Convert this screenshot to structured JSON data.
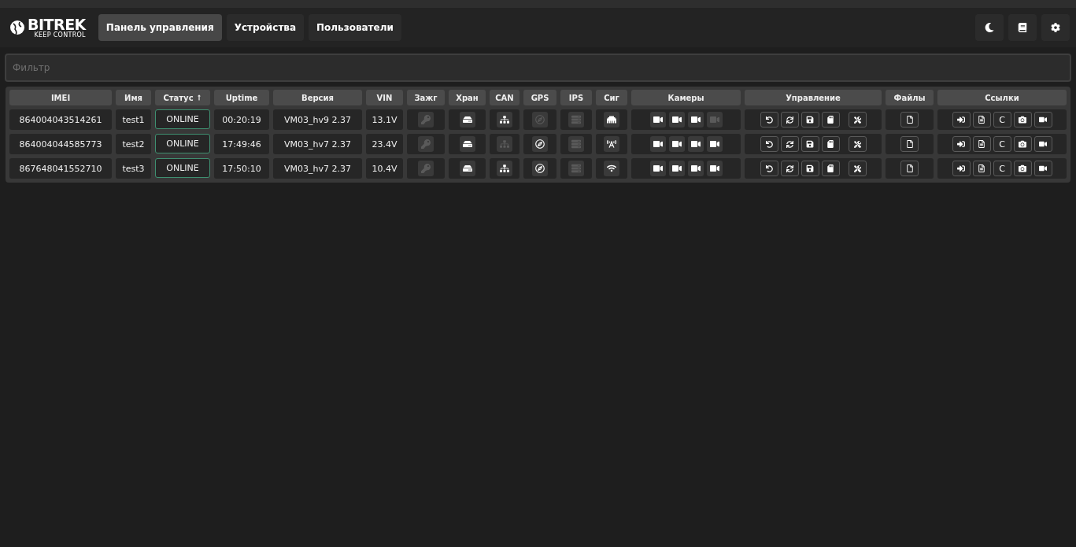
{
  "header": {
    "logo": {
      "brand": "BITREK",
      "tagline": "KEEP CONTROL"
    },
    "tabs": [
      {
        "label": "Панель управления",
        "selected": true
      },
      {
        "label": "Устройства",
        "selected": false
      },
      {
        "label": "Пользователи",
        "selected": false
      }
    ]
  },
  "filter": {
    "placeholder": "Фильтр"
  },
  "table": {
    "columns": [
      {
        "label": "IMEI"
      },
      {
        "label": "Имя"
      },
      {
        "label": "Статус",
        "sorted": true
      },
      {
        "label": "Uptime"
      },
      {
        "label": "Версия"
      },
      {
        "label": "VIN"
      },
      {
        "label": "Зажг"
      },
      {
        "label": "Хран"
      },
      {
        "label": "CAN"
      },
      {
        "label": "GPS"
      },
      {
        "label": "IPS"
      },
      {
        "label": "Сиг"
      },
      {
        "label": "Камеры"
      },
      {
        "label": "Управление"
      },
      {
        "label": "Файлы"
      },
      {
        "label": "Ссылки"
      }
    ],
    "rows": [
      {
        "imei": "864004043514261",
        "name": "test1",
        "status": "ONLINE",
        "uptime": "00:20:19",
        "version": "VM03_hv9 2.37",
        "vin": "13.1V",
        "ignition_on": false,
        "storage_on": true,
        "can_on": true,
        "gps_on": false,
        "ips_on": false,
        "signal": {
          "kind": "ethernet"
        },
        "cameras": [
          true,
          true,
          true,
          false
        ],
        "link_text": "C"
      },
      {
        "imei": "864004044585773",
        "name": "test2",
        "status": "ONLINE",
        "uptime": "17:49:46",
        "version": "VM03_hv7 2.37",
        "vin": "23.4V",
        "ignition_on": false,
        "storage_on": true,
        "can_on": false,
        "gps_on": true,
        "ips_on": false,
        "signal": {
          "kind": "cellular"
        },
        "cameras": [
          true,
          true,
          true,
          true
        ],
        "link_text": "C"
      },
      {
        "imei": "867648041552710",
        "name": "test3",
        "status": "ONLINE",
        "uptime": "17:50:10",
        "version": "VM03_hv7 2.37",
        "vin": "10.4V",
        "ignition_on": false,
        "storage_on": true,
        "can_on": true,
        "gps_on": true,
        "ips_on": false,
        "signal": {
          "kind": "wifi"
        },
        "cameras": [
          true,
          true,
          true,
          true
        ],
        "link_text": "C"
      }
    ]
  }
}
